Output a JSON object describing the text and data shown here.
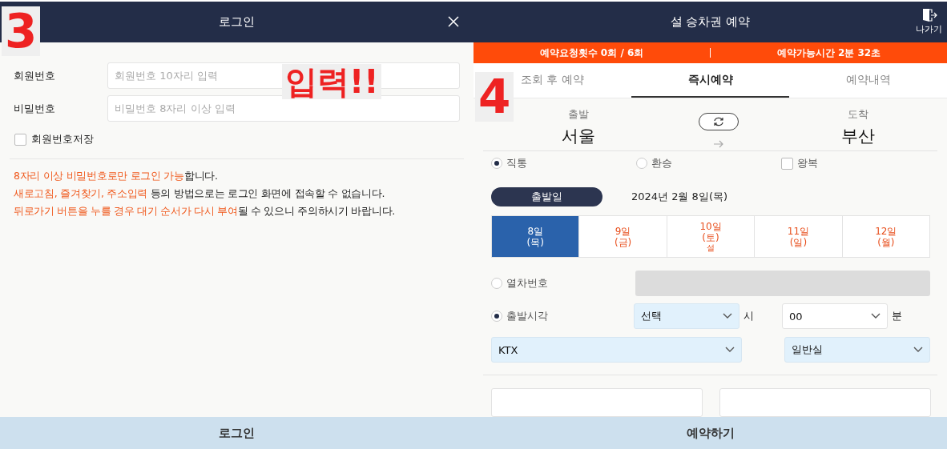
{
  "login_dialog": {
    "title": "로그인",
    "fields": [
      {
        "label": "회원번호",
        "placeholder": "회원번호 10자리 입력"
      },
      {
        "label": "비밀번호",
        "placeholder": "비밀번호 8자리 이상 입력"
      }
    ],
    "remember": {
      "label": "회원번호저장",
      "checked": false
    },
    "notices": [
      [
        {
          "text": "8자리 이상 비밀번호로만 로그인 가능",
          "highlight": true
        },
        {
          "text": "합니다.",
          "highlight": false
        }
      ],
      [
        {
          "text": "새로고침, 즐겨찾기, 주소입력",
          "highlight": true
        },
        {
          "text": " 등의 방법으로는 로그인 화면에 접속할 수 없습니다.",
          "highlight": false
        }
      ],
      [
        {
          "text": "뒤로가기 버튼을 누를 경우 대기 순서가 다시 부여",
          "highlight": true
        },
        {
          "text": "될 수 있으니 주의하시기 바랍니다.",
          "highlight": false
        }
      ]
    ],
    "submit": "로그인"
  },
  "booking": {
    "title": "설 승차권 예약",
    "exit_label": "나가기",
    "status": [
      "예약요청횟수 0회 / 6회",
      "예약가능시간 2분 32초"
    ],
    "tabs": [
      {
        "label": "조회 후 예약",
        "selected": false
      },
      {
        "label": "즉시예약",
        "selected": true
      },
      {
        "label": "예약내역",
        "selected": false
      }
    ],
    "departure": {
      "label": "출발",
      "value": "서울"
    },
    "arrival": {
      "label": "도착",
      "value": "부산"
    },
    "trip_types": [
      {
        "kind": "radio",
        "label": "직통",
        "selected": true
      },
      {
        "kind": "radio",
        "label": "환승",
        "selected": false
      },
      {
        "kind": "checkbox",
        "label": "왕복",
        "checked": false
      }
    ],
    "date_button": "출발일",
    "date_text": "2024년 2월 8일(목)",
    "dates": [
      {
        "day": "8일",
        "weekday": "(목)",
        "selected": true
      },
      {
        "day": "9일",
        "weekday": "(금)",
        "selected": false
      },
      {
        "day": "10일",
        "weekday": "(토)",
        "note": "설",
        "selected": false
      },
      {
        "day": "11일",
        "weekday": "(일)",
        "selected": false
      },
      {
        "day": "12일",
        "weekday": "(월)",
        "selected": false
      }
    ],
    "search_modes": [
      {
        "label": "열차번호",
        "selected": false
      },
      {
        "label": "출발시각",
        "selected": true
      }
    ],
    "hour": {
      "value": "선택",
      "unit": "시"
    },
    "minute": {
      "value": "00",
      "unit": "분"
    },
    "train_type": "KTX",
    "seat_class": "일반실",
    "submit": "예약하기"
  },
  "annotations": [
    "3",
    "입력!!",
    "4"
  ]
}
